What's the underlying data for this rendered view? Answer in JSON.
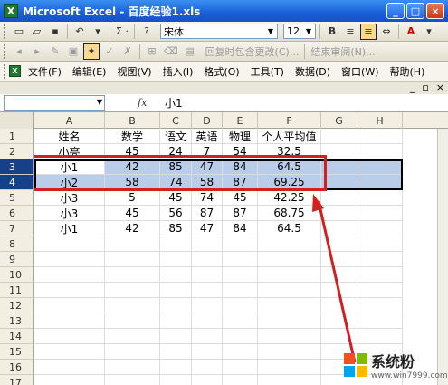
{
  "window": {
    "title": "Microsoft Excel - 百度经验1.xls",
    "app_badge": "X"
  },
  "toolbar1": {
    "undo": "↶",
    "sum": "Σ ·",
    "help": "?",
    "font": "宋体",
    "size": "12",
    "bold": "B",
    "italic": "I",
    "underline": "U",
    "font_color": "A"
  },
  "toolbar2": {
    "reply_label": "回复时包含更改(C)...",
    "end_review_label": "结束审阅(N)..."
  },
  "menubar": {
    "items": [
      "文件(F)",
      "编辑(E)",
      "视图(V)",
      "插入(I)",
      "格式(O)",
      "工具(T)",
      "数据(D)",
      "窗口(W)",
      "帮助(H)"
    ],
    "minimize": "_",
    "restore": "▫",
    "close": "×"
  },
  "formula": {
    "namebox": "",
    "fx": "fx",
    "value": "小1"
  },
  "columns": [
    "A",
    "B",
    "C",
    "D",
    "E",
    "F",
    "G",
    "H"
  ],
  "rows": [
    {
      "num": "1",
      "cells": [
        "姓名",
        "数学",
        "语文",
        "英语",
        "物理",
        "个人平均值"
      ]
    },
    {
      "num": "2",
      "cells": [
        "小亮",
        "45",
        "24",
        "7",
        "54",
        "32.5"
      ]
    },
    {
      "num": "3",
      "cells": [
        "小1",
        "42",
        "85",
        "47",
        "84",
        "64.5"
      ]
    },
    {
      "num": "4",
      "cells": [
        "小2",
        "58",
        "74",
        "58",
        "87",
        "69.25"
      ]
    },
    {
      "num": "5",
      "cells": [
        "小3",
        "5",
        "45",
        "74",
        "45",
        "42.25"
      ]
    },
    {
      "num": "6",
      "cells": [
        "小3",
        "45",
        "56",
        "87",
        "87",
        "68.75"
      ]
    },
    {
      "num": "7",
      "cells": [
        "小1",
        "42",
        "85",
        "47",
        "84",
        "64.5"
      ]
    },
    {
      "num": "8",
      "cells": []
    },
    {
      "num": "9",
      "cells": []
    },
    {
      "num": "10",
      "cells": []
    },
    {
      "num": "11",
      "cells": []
    },
    {
      "num": "12",
      "cells": []
    },
    {
      "num": "13",
      "cells": []
    },
    {
      "num": "14",
      "cells": []
    },
    {
      "num": "15",
      "cells": []
    },
    {
      "num": "16",
      "cells": []
    },
    {
      "num": "17",
      "cells": []
    }
  ],
  "selected_rows": [
    "3",
    "4"
  ],
  "watermark": {
    "title": "系统粉",
    "url": "www.win7999.com"
  },
  "colors": {
    "selection": "#b9cde8",
    "annotation": "#d21f1f",
    "title_bar": "#1a5fd6"
  }
}
